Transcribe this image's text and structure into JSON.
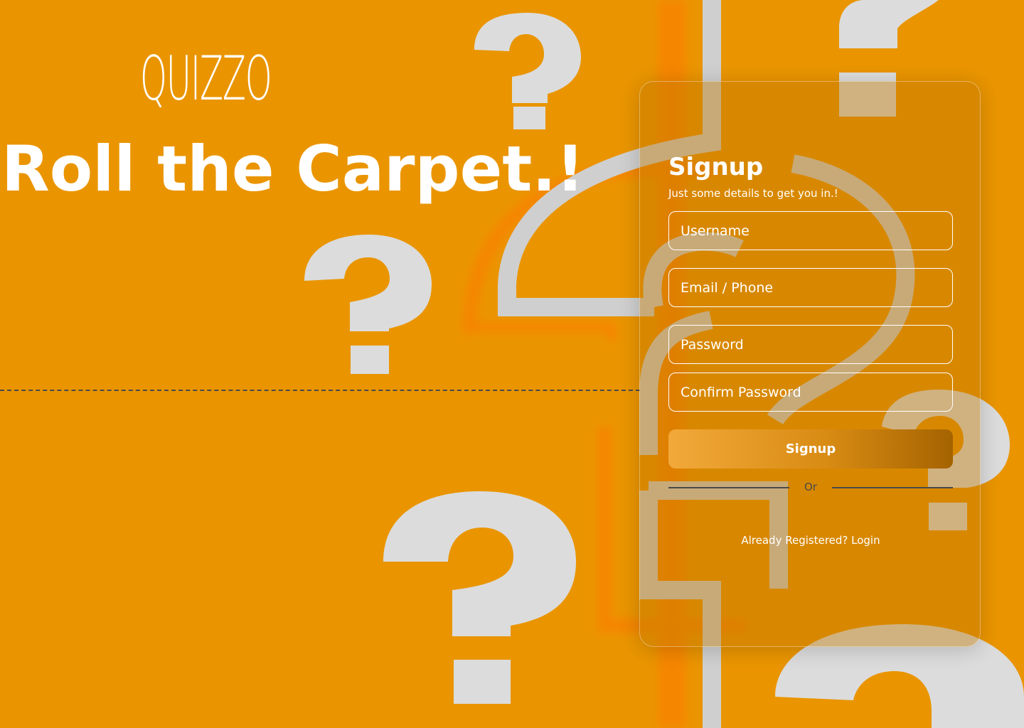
{
  "brand": {
    "logo_text": "QUIZZO"
  },
  "hero": {
    "headline": "Roll the Carpet.!"
  },
  "background": {
    "color": "#EA9500",
    "decor_icon": "question-mark-icon",
    "decor_color": "#DCDCDC"
  },
  "signup": {
    "title": "Signup",
    "subtitle": "Just some details to get you in.!",
    "fields": {
      "username_placeholder": "Username",
      "email_placeholder": "Email / Phone",
      "password_placeholder": "Password",
      "confirm_password_placeholder": "Confirm Password"
    },
    "submit_label": "Signup",
    "divider_label": "Or",
    "login_prompt": "Already Registered? Login"
  }
}
